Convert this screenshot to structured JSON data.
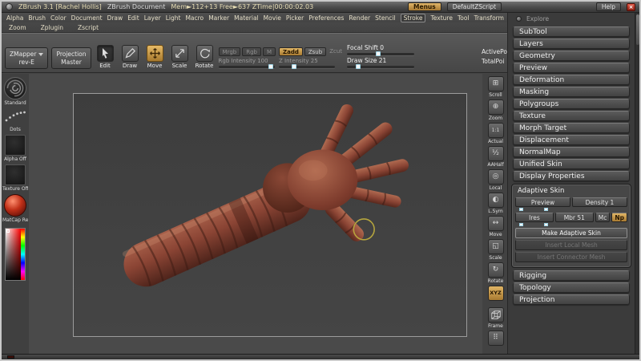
{
  "titlebar": {
    "app_title": "ZBrush  3.1 [Rachel Hollis]",
    "doc_title": "ZBrush Document",
    "stats": "Mem►112+13  Free►637  ZTime|00:00:02.03",
    "menus_button": "Menus",
    "zscript_button": "DefaultZScript",
    "help_button": "Help",
    "close_glyph": "×"
  },
  "menu_items": [
    "Alpha",
    "Brush",
    "Color",
    "Document",
    "Draw",
    "Edit",
    "Layer",
    "Light",
    "Macro",
    "Marker",
    "Material",
    "Movie",
    "Picker",
    "Preferences",
    "Render",
    "Stencil",
    "Stroke",
    "Texture",
    "Tool",
    "Transform"
  ],
  "menu_items_row2": [
    "Zoom",
    "Zplugin",
    "Zscript"
  ],
  "toolbar": {
    "zmapper_label": "ZMapper",
    "zmapper_rev": "rev-E",
    "projection_line1": "Projection",
    "projection_line2": "Master",
    "edit_label": "Edit",
    "draw_label": "Draw",
    "move_label": "Move",
    "scale_label": "Scale",
    "rotate_label": "Rotate",
    "mrgb_label": "Mrgb",
    "rgb_label": "Rgb",
    "m_label": "M",
    "rgb_intensity_label": "Rgb Intensity 100",
    "zadd_label": "Zadd",
    "zsub_label": "Zsub",
    "zcut_label": "Zcut",
    "z_intensity_label": "Z Intensity 25",
    "focal_shift_label": "Focal Shift 0",
    "draw_size_label": "Draw Size 21",
    "active_points_label": "ActivePo",
    "total_points_label": "TotalPoi"
  },
  "left_shelf": {
    "brush_label": "Standard",
    "stroke_label": "Dots",
    "alpha_label": "Alpha Off",
    "texture_label": "Texture Off",
    "material_label": "MatCap Red Wa"
  },
  "right_shelf": {
    "items": [
      {
        "name": "scroll",
        "label": "Scroll",
        "glyph": "⊞"
      },
      {
        "name": "zoom",
        "label": "Zoom",
        "glyph": "⊕"
      },
      {
        "name": "actual",
        "label": "Actual",
        "glyph": "1:1"
      },
      {
        "name": "aahalf",
        "label": "AAHalf",
        "glyph": "½"
      },
      {
        "name": "local",
        "label": "Local",
        "glyph": "◎"
      },
      {
        "name": "lsym",
        "label": "L.Sym",
        "glyph": "◐"
      },
      {
        "name": "move",
        "label": "Move",
        "glyph": "↔"
      },
      {
        "name": "scale",
        "label": "Scale",
        "glyph": "◱"
      },
      {
        "name": "rotate",
        "label": "Rotate",
        "glyph": "↻"
      }
    ],
    "xyz_label": "XYZ",
    "frame_label": "Frame",
    "dots_glyph": "⠿"
  },
  "tool_panel": {
    "header": "Explore",
    "items": [
      "SubTool",
      "Layers",
      "Geometry",
      "Preview",
      "Deformation",
      "Masking",
      "Polygroups",
      "Texture",
      "Morph Target",
      "Displacement",
      "NormalMap",
      "Unified Skin",
      "Display Properties"
    ],
    "adaptive_skin": {
      "title": "Adaptive Skin",
      "preview_label": "Preview",
      "density_label": "Density 1",
      "ires_label": "Ires",
      "mbr_label": "Mbr 51",
      "mc_label": "Mc",
      "np_label": "Np",
      "make_label": "Make Adaptive Skin",
      "insert_local_label": "Insert Local Mesh",
      "insert_connector_label": "Insert Connector Mesh"
    },
    "items_bottom": [
      "Rigging",
      "Topology",
      "Projection"
    ]
  },
  "colors": {
    "accent_tan": "#d8ab55",
    "model_base": "#8a4434",
    "cursor_yellow": "#b8a83c"
  }
}
